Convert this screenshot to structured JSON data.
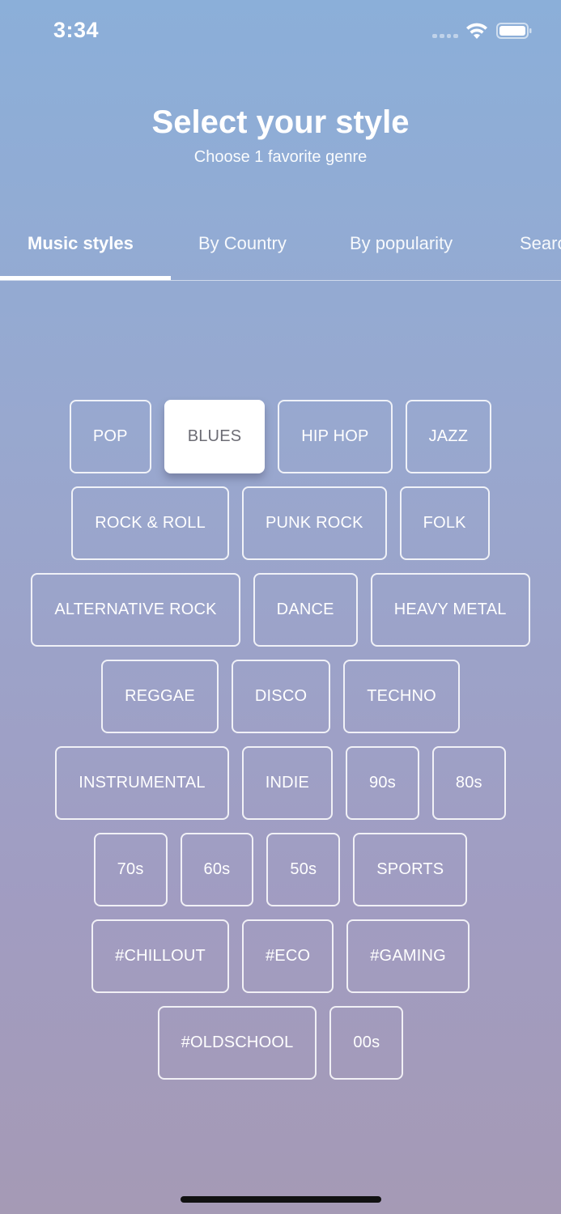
{
  "status_bar": {
    "time": "3:34"
  },
  "header": {
    "title": "Select your style",
    "subtitle": "Choose 1 favorite genre"
  },
  "tabs": [
    {
      "label": "Music styles",
      "active": true
    },
    {
      "label": "By Country",
      "active": false
    },
    {
      "label": "By popularity",
      "active": false
    },
    {
      "label": "Search",
      "active": false
    }
  ],
  "genres": {
    "selected": "BLUES",
    "rows": [
      [
        "POP",
        "BLUES",
        "HIP HOP",
        "JAZZ"
      ],
      [
        "ROCK & ROLL",
        "PUNK ROCK",
        "FOLK"
      ],
      [
        "ALTERNATIVE ROCK",
        "DANCE",
        "HEAVY METAL"
      ],
      [
        "REGGAE",
        "DISCO",
        "TECHNO"
      ],
      [
        "INSTRUMENTAL",
        "INDIE",
        "90s",
        "80s"
      ],
      [
        "70s",
        "60s",
        "50s",
        "SPORTS"
      ],
      [
        "#CHILLOUT",
        "#ECO",
        "#GAMING"
      ],
      [
        "#OLDSCHOOL",
        "00s"
      ]
    ]
  },
  "colors": {
    "gradient_top": "#8bafd9",
    "gradient_bottom": "#a59ab5",
    "selected_chip_bg": "#ffffff",
    "selected_chip_text": "#6c6c74"
  },
  "icons": {
    "status": [
      "signal-dots-icon",
      "wifi-icon",
      "battery-icon"
    ]
  }
}
